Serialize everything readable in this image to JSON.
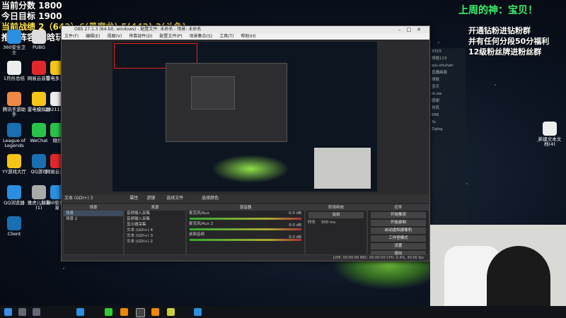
{
  "overlay": {
    "score_total": "当前分数 1800",
    "target": "今日目标 1900",
    "record": "当前战绩 2（642）6(黑魔龙) 5(442) 3(斗鱼)",
    "recommend": "推荐阵容 胡晗玩啥"
  },
  "top_right": {
    "last_week_god": "上周的神：宝贝！",
    "rights": [
      "开通钻粉进钻粉群",
      "并有任何分段50分福利",
      "12级粉丝牌进粉丝群"
    ]
  },
  "desktop_icons": [
    {
      "label": "360安全卫士",
      "color": "#2a8fe0"
    },
    {
      "label": "PUBG",
      "color": "#ddd"
    },
    {
      "label": "1月份总结",
      "color": "#eee"
    },
    {
      "label": "网易云音乐",
      "color": "#e0282c"
    },
    {
      "label": "雷电多开器",
      "color": "#f5c518"
    },
    {
      "label": "腾讯手游助手",
      "color": "#e84"
    },
    {
      "label": "雷电模拟器",
      "color": "#f5c518"
    },
    {
      "label": "2021123...",
      "color": "#eee"
    },
    {
      "label": "League of Legends",
      "color": "#1a6fb0"
    },
    {
      "label": "WeChat",
      "color": "#2ac34a"
    },
    {
      "label": "微信",
      "color": "#2ac34a"
    },
    {
      "label": "YY游戏大厅",
      "color": "#f5c518"
    },
    {
      "label": "QQ游戏",
      "color": "#1a6fb0"
    },
    {
      "label": "网易云游戏",
      "color": "#e0282c"
    },
    {
      "label": "QQ浏览器",
      "color": "#2a8fe0"
    },
    {
      "label": "雅虎儿翻看(1)",
      "color": "#aaa"
    },
    {
      "label": "360软件管家",
      "color": "#2a8fe0"
    },
    {
      "label": "Client",
      "color": "#1a6fb0"
    }
  ],
  "right_desktop_icon": {
    "label": "新建文本文档(4)"
  },
  "obs": {
    "title": "OBS 27.1.3 (64-bit, windows) - 配置文件: 未命名 - 场景: 未命名",
    "menu": [
      "文件(F)",
      "编辑(E)",
      "视图(V)",
      "停靠部件(D)",
      "配置文件(P)",
      "场景集合(S)",
      "工具(T)",
      "帮助(H)"
    ],
    "source_bar": [
      "文本 (GDI+) 3",
      "属性",
      "滤镜",
      "选择文件",
      "选择颜色"
    ],
    "docks": {
      "scenes": {
        "title": "场景",
        "items": [
          "场景",
          "场景 2"
        ]
      },
      "sources": {
        "title": "来源",
        "items": [
          "音频输入采集",
          "音频输入采集",
          "显示器采集",
          "文本 (GDI+) 4",
          "文本 (GDI+) 3",
          "文本 (GDI+) 2"
        ]
      },
      "mixer": {
        "title": "混音器",
        "items": [
          "麦克风/Aux",
          "麦克风/Aux 2",
          "桌面音频"
        ],
        "db": [
          "-0.0 dB",
          "0.0 dB",
          "0.0 dB"
        ]
      },
      "transitions": {
        "title": "转场特效",
        "type": "淡出",
        "duration_label": "时长",
        "duration": "300 ms"
      },
      "controls": {
        "title": "控件",
        "buttons": [
          "开始推流",
          "开始录制",
          "启动虚拟摄像机",
          "工作室模式",
          "设置",
          "退出"
        ]
      }
    },
    "status": "LIVE: 00:00:00   REC: 00:00:00   CPU: 0.4%, 30.00 fps"
  },
  "chat_lines": [
    "3315",
    "胡晗123",
    "qiu-shuhah",
    "直播画面",
    "胡晗",
    "宝贝",
    "dr.zw",
    "感谢",
    "扶风",
    "666",
    "3c",
    "Zqiog"
  ]
}
